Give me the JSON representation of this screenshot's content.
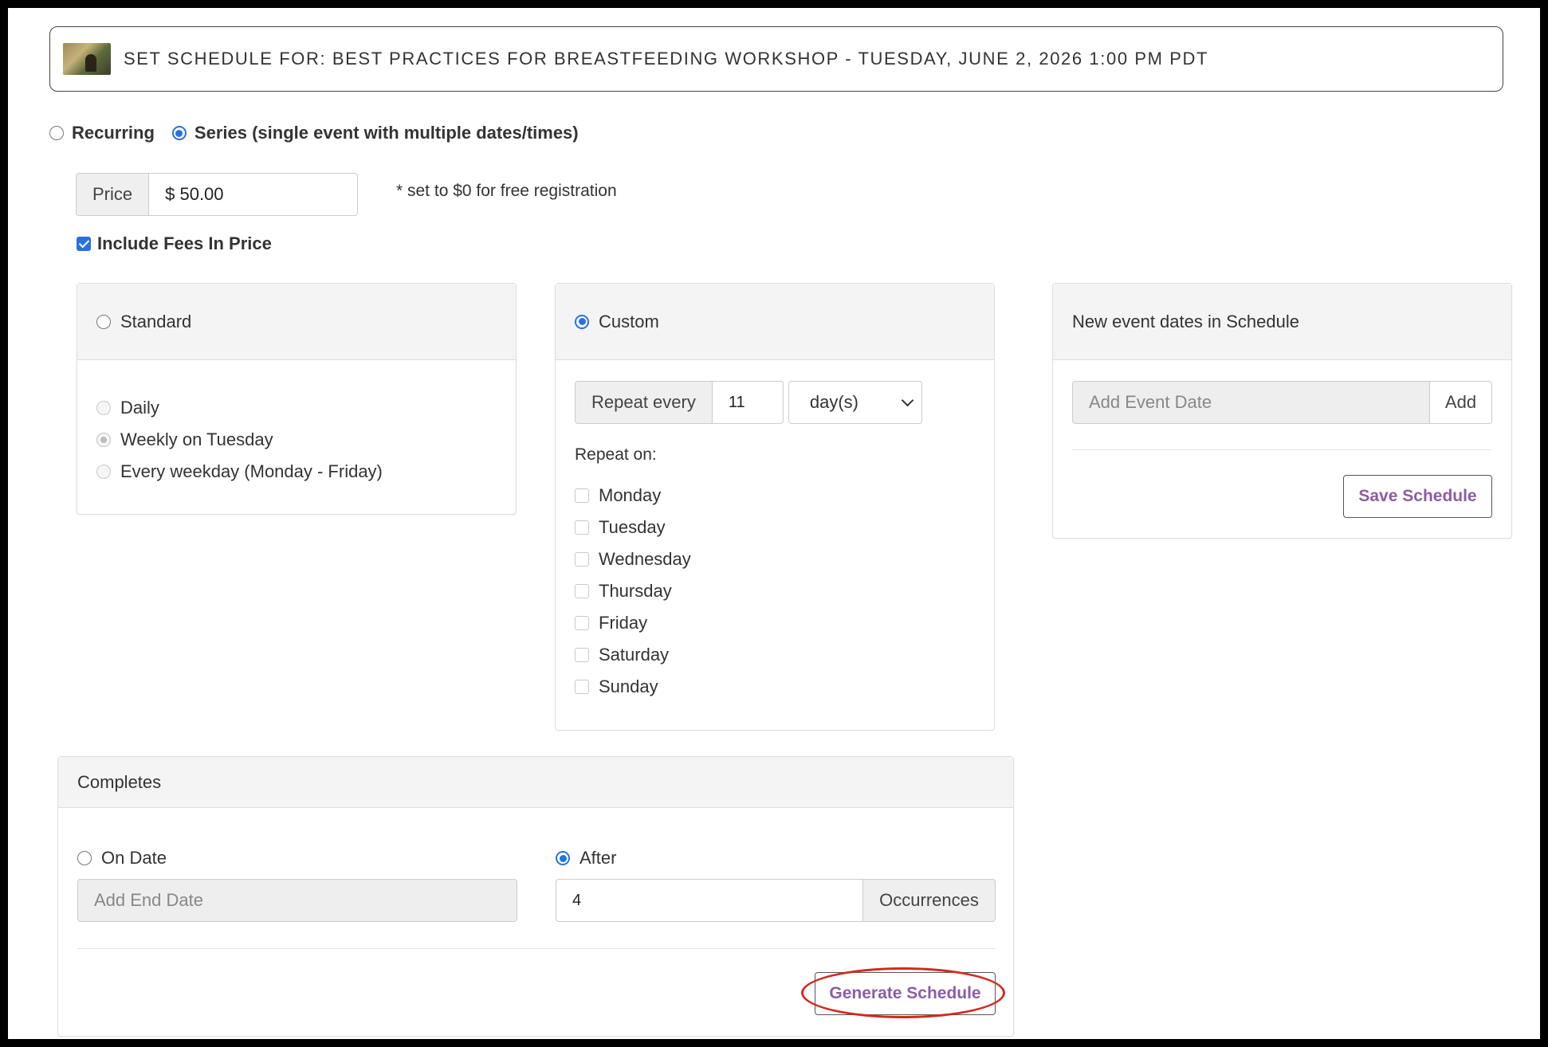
{
  "header": {
    "title": "SET SCHEDULE FOR: BEST PRACTICES FOR BREASTFEEDING WORKSHOP - TUESDAY, JUNE 2, 2026 1:00 PM PDT"
  },
  "mode": {
    "recurring_label": "Recurring",
    "series_label": "Series (single event with multiple dates/times)",
    "selected": "series"
  },
  "price": {
    "label": "Price",
    "value": "$ 50.00",
    "note": "* set to $0 for free registration"
  },
  "fees": {
    "label": "Include Fees In Price",
    "checked": true
  },
  "standard": {
    "label": "Standard",
    "options": [
      "Daily",
      "Weekly on Tuesday",
      "Every weekday (Monday - Friday)"
    ],
    "selected_option": "Weekly on Tuesday"
  },
  "custom": {
    "label": "Custom",
    "repeat_every_label": "Repeat every",
    "repeat_every_value": "11",
    "unit_value": "day(s)",
    "repeat_on_label": "Repeat on:",
    "days": [
      "Monday",
      "Tuesday",
      "Wednesday",
      "Thursday",
      "Friday",
      "Saturday",
      "Sunday"
    ]
  },
  "new_dates": {
    "title": "New event dates in Schedule",
    "input_placeholder": "Add Event Date",
    "add_label": "Add",
    "save_label": "Save Schedule"
  },
  "completes": {
    "title": "Completes",
    "on_date_label": "On Date",
    "end_date_placeholder": "Add End Date",
    "after_label": "After",
    "occurrences_value": "4",
    "occurrences_label": "Occurrences",
    "generate_label": "Generate Schedule"
  },
  "colors": {
    "accent": "#2872e0",
    "button_text": "#8a5ea6",
    "highlight": "#d32a1e"
  }
}
